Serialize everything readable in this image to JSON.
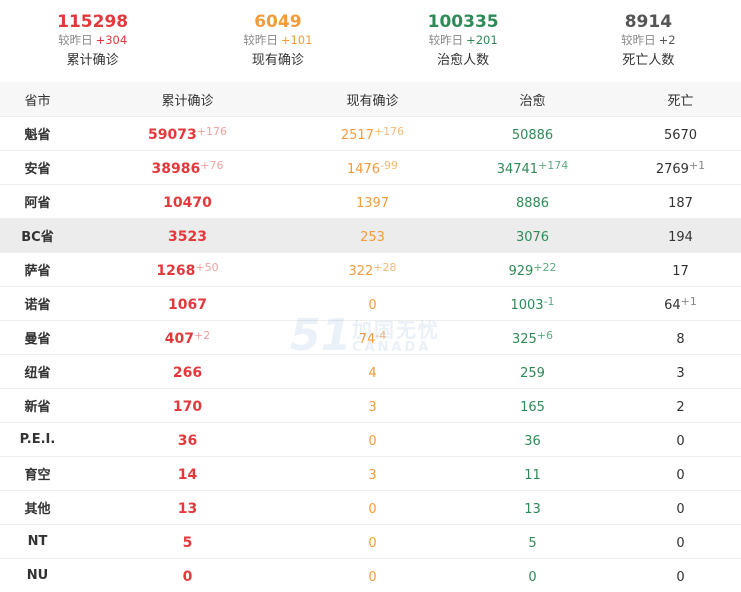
{
  "summary": [
    {
      "value": "115298",
      "delta_label": "较昨日",
      "delta": "+304",
      "label": "累计确诊",
      "color": "#e4393c"
    },
    {
      "value": "6049",
      "delta_label": "较昨日",
      "delta": "+101",
      "label": "现有确诊",
      "color": "#f39c3c"
    },
    {
      "value": "100335",
      "delta_label": "较昨日",
      "delta": "+201",
      "label": "治愈人数",
      "color": "#2e8b57"
    },
    {
      "value": "8914",
      "delta_label": "较昨日",
      "delta": "+2",
      "label": "死亡人数",
      "color": "#555555"
    }
  ],
  "table": {
    "headers": [
      "省市",
      "累计确诊",
      "现有确诊",
      "治愈",
      "死亡"
    ],
    "rows": [
      {
        "prov": "魁省",
        "cum": "59073",
        "cum_inc": "+176",
        "cur": "2517",
        "cur_inc": "+176",
        "rec": "50886",
        "rec_inc": "",
        "dead": "5670",
        "dead_inc": ""
      },
      {
        "prov": "安省",
        "cum": "38986",
        "cum_inc": "+76",
        "cur": "1476",
        "cur_inc": "-99",
        "rec": "34741",
        "rec_inc": "+174",
        "dead": "2769",
        "dead_inc": "+1"
      },
      {
        "prov": "阿省",
        "cum": "10470",
        "cum_inc": "",
        "cur": "1397",
        "cur_inc": "",
        "rec": "8886",
        "rec_inc": "",
        "dead": "187",
        "dead_inc": ""
      },
      {
        "prov": "BC省",
        "cum": "3523",
        "cum_inc": "",
        "cur": "253",
        "cur_inc": "",
        "rec": "3076",
        "rec_inc": "",
        "dead": "194",
        "dead_inc": ""
      },
      {
        "prov": "萨省",
        "cum": "1268",
        "cum_inc": "+50",
        "cur": "322",
        "cur_inc": "+28",
        "rec": "929",
        "rec_inc": "+22",
        "dead": "17",
        "dead_inc": ""
      },
      {
        "prov": "诺省",
        "cum": "1067",
        "cum_inc": "",
        "cur": "0",
        "cur_inc": "",
        "rec": "1003",
        "rec_inc": "-1",
        "dead": "64",
        "dead_inc": "+1"
      },
      {
        "prov": "曼省",
        "cum": "407",
        "cum_inc": "+2",
        "cur": "74",
        "cur_inc": "-4",
        "rec": "325",
        "rec_inc": "+6",
        "dead": "8",
        "dead_inc": ""
      },
      {
        "prov": "纽省",
        "cum": "266",
        "cum_inc": "",
        "cur": "4",
        "cur_inc": "",
        "rec": "259",
        "rec_inc": "",
        "dead": "3",
        "dead_inc": ""
      },
      {
        "prov": "新省",
        "cum": "170",
        "cum_inc": "",
        "cur": "3",
        "cur_inc": "",
        "rec": "165",
        "rec_inc": "",
        "dead": "2",
        "dead_inc": ""
      },
      {
        "prov": "P.E.I.",
        "cum": "36",
        "cum_inc": "",
        "cur": "0",
        "cur_inc": "",
        "rec": "36",
        "rec_inc": "",
        "dead": "0",
        "dead_inc": ""
      },
      {
        "prov": "育空",
        "cum": "14",
        "cum_inc": "",
        "cur": "3",
        "cur_inc": "",
        "rec": "11",
        "rec_inc": "",
        "dead": "0",
        "dead_inc": ""
      },
      {
        "prov": "其他",
        "cum": "13",
        "cum_inc": "",
        "cur": "0",
        "cur_inc": "",
        "rec": "13",
        "rec_inc": "",
        "dead": "0",
        "dead_inc": ""
      },
      {
        "prov": "NT",
        "cum": "5",
        "cum_inc": "",
        "cur": "0",
        "cur_inc": "",
        "rec": "5",
        "rec_inc": "",
        "dead": "0",
        "dead_inc": ""
      },
      {
        "prov": "NU",
        "cum": "0",
        "cum_inc": "",
        "cur": "0",
        "cur_inc": "",
        "rec": "0",
        "rec_inc": "",
        "dead": "0",
        "dead_inc": ""
      }
    ],
    "highlighted_row": "BC省"
  },
  "watermark": {
    "num": "51",
    "cn": "加国无忧",
    "en": "CANADA"
  }
}
